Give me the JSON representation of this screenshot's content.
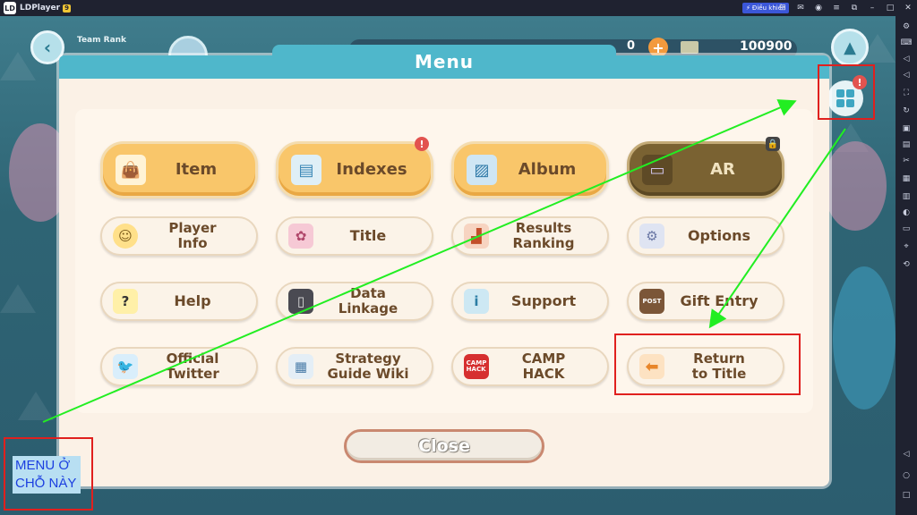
{
  "window": {
    "app_name": "LDPlayer",
    "version_badge": "9",
    "control_button": "Điều khiển"
  },
  "hud": {
    "team_rank_label": "Team Rank",
    "currency_amount": "0",
    "coins": "100900"
  },
  "menu": {
    "title": "Menu",
    "buttons": {
      "item": "Item",
      "indexes": "Indexes",
      "album": "Album",
      "ar": "AR",
      "player_info_1": "Player",
      "player_info_2": "Info",
      "title": "Title",
      "results_ranking_1": "Results",
      "results_ranking_2": "Ranking",
      "options": "Options",
      "help": "Help",
      "data_linkage_1": "Data",
      "data_linkage_2": "Linkage",
      "support": "Support",
      "gift_entry": "Gift Entry",
      "official_twitter_1": "Official",
      "official_twitter_2": "Twitter",
      "strategy_guide_1": "Strategy",
      "strategy_guide_2": "Guide Wiki",
      "camp_hack_1": "CAMP",
      "camp_hack_2": "HACK",
      "return_title_1": "Return",
      "return_title_2": "to Title"
    },
    "close": "Close"
  },
  "annotation": {
    "line1": "MENU Ở",
    "line2": "CHỖ NÀY",
    "arrow_color": "#22ee22",
    "box_color": "#e0201e"
  }
}
